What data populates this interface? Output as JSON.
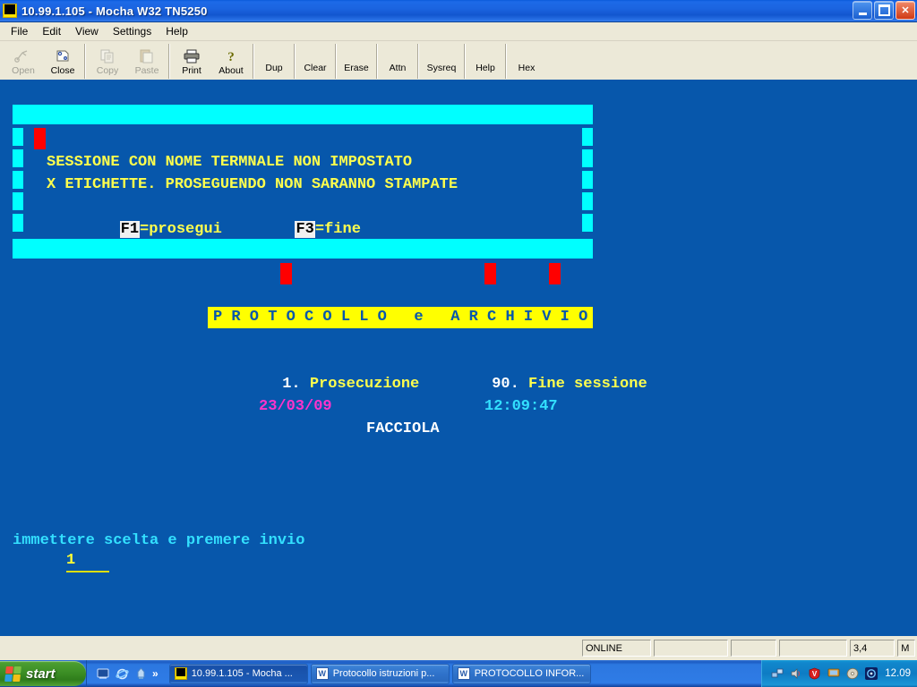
{
  "window": {
    "title": "10.99.1.105 - Mocha W32 TN5250",
    "icon": "terminal-icon",
    "controls": {
      "minimize": "minimize-icon",
      "maximize": "maximize-icon",
      "close": "close-icon"
    }
  },
  "menu": {
    "items": [
      {
        "label": "File"
      },
      {
        "label": "Edit"
      },
      {
        "label": "View"
      },
      {
        "label": "Settings"
      },
      {
        "label": "Help"
      }
    ]
  },
  "toolbar": {
    "buttons": [
      {
        "label": "Open",
        "icon": "open-folder-icon",
        "enabled": false
      },
      {
        "label": "Close",
        "icon": "close-session-icon",
        "enabled": true
      },
      {
        "label": "Copy",
        "icon": "copy-icon",
        "enabled": false
      },
      {
        "label": "Paste",
        "icon": "paste-icon",
        "enabled": false
      },
      {
        "label": "Print",
        "icon": "printer-icon",
        "enabled": true
      },
      {
        "label": "About",
        "icon": "question-mark-icon",
        "enabled": true
      },
      {
        "label": "Dup",
        "icon": "",
        "enabled": true
      },
      {
        "label": "Clear",
        "icon": "",
        "enabled": true
      },
      {
        "label": "Erase",
        "icon": "",
        "enabled": true
      },
      {
        "label": "Attn",
        "icon": "",
        "enabled": true
      },
      {
        "label": "Sysreq",
        "icon": "",
        "enabled": true
      },
      {
        "label": "Help",
        "icon": "",
        "enabled": true
      },
      {
        "label": "Hex",
        "icon": "",
        "enabled": true
      }
    ]
  },
  "terminal": {
    "colors": {
      "background": "#0757ab",
      "cyan": "#00ffff",
      "yellow": "#ffff4d",
      "white": "#ffffff",
      "magenta": "#ff33cc",
      "red": "#ff0000",
      "banner_bg": "#ffff00"
    },
    "dialog": {
      "line1": "SESSIONE CON NOME TERMNALE NON IMPOSTATO",
      "line2": "X ETICHETTE. PROSEGUENDO NON SARANNO STAMPATE",
      "key1_name": "F1",
      "key1_label": "=prosegui",
      "key2_name": "F3",
      "key2_label": "=fine"
    },
    "banner": "P R O T O C O L L O   e   A R C H I V I O",
    "menu_options": [
      {
        "number": "1.",
        "label": "Prosecuzione"
      },
      {
        "number": "90.",
        "label": "Fine sessione"
      }
    ],
    "date": "23/03/09",
    "time": "12:09:47",
    "user": "FACCIOLA",
    "prompt": "immettere scelta e premere invio",
    "input_value": "1"
  },
  "status_bar": {
    "connection": "ONLINE",
    "field_b": "",
    "field_c": "",
    "field_d": "",
    "position": "3,4",
    "mode": "M"
  },
  "taskbar": {
    "start_label": "start",
    "quick_launch": [
      {
        "icon": "show-desktop-icon"
      },
      {
        "icon": "internet-explorer-icon"
      },
      {
        "icon": "windows-media-icon"
      },
      {
        "icon": "chevron-right-icon"
      }
    ],
    "tasks": [
      {
        "label": "10.99.1.105 - Mocha ...",
        "icon": "terminal-icon",
        "active": true
      },
      {
        "label": "Protocollo istruzioni p...",
        "icon": "word-icon",
        "active": false
      },
      {
        "label": "PROTOCOLLO INFOR...",
        "icon": "word-icon",
        "active": false
      }
    ],
    "tray_icons": [
      {
        "icon": "network-icon"
      },
      {
        "icon": "volume-speaker-icon"
      },
      {
        "icon": "antivirus-shield-icon"
      },
      {
        "icon": "display-icon"
      },
      {
        "icon": "disk-icon"
      },
      {
        "icon": "media-player-icon"
      }
    ],
    "clock": "12.09"
  }
}
